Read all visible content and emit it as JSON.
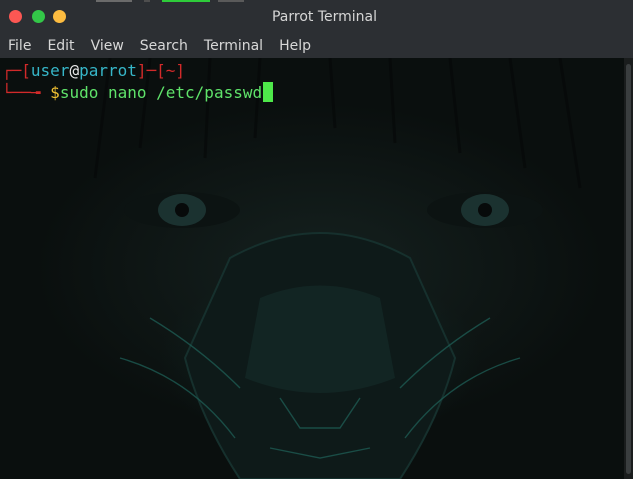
{
  "window": {
    "title": "Parrot Terminal",
    "buttons": {
      "close_color": "#fc5753",
      "maximize_color": "#33c748",
      "minimize_color": "#fdbc40"
    }
  },
  "menu": {
    "items": [
      {
        "label": "File"
      },
      {
        "label": "Edit"
      },
      {
        "label": "View"
      },
      {
        "label": "Search"
      },
      {
        "label": "Terminal"
      },
      {
        "label": "Help"
      }
    ]
  },
  "prompt": {
    "user": "user",
    "at": "@",
    "host": "parrot",
    "dir": "~",
    "symbol": "$",
    "command": "sudo nano /etc/passwd"
  },
  "colors": {
    "prompt_frame": "#d22a2a",
    "user": "#36b6c8",
    "host": "#36b6c8",
    "dollar": "#f2c232",
    "command": "#5fe36a",
    "cursor": "#4ee84a"
  }
}
